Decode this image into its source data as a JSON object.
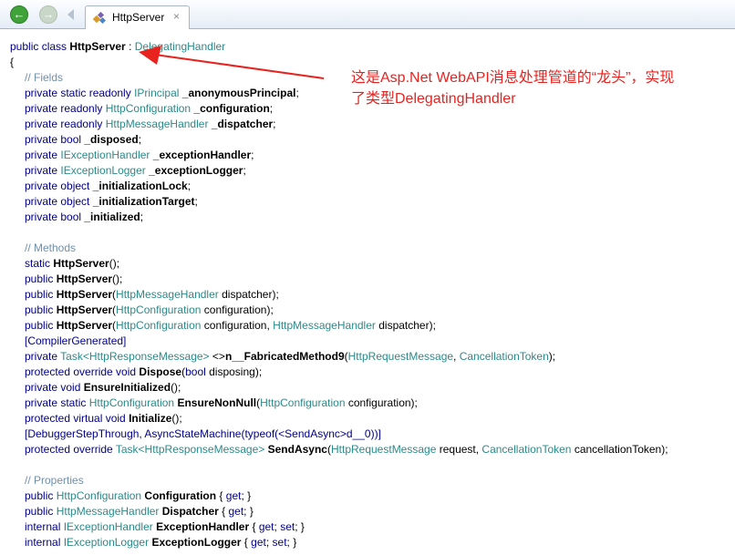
{
  "toolbar": {
    "back_glyph": "←",
    "forward_glyph": "→",
    "tab_title": "HttpServer",
    "tab_close": "×"
  },
  "code": {
    "class_decl": [
      "public class ",
      "HttpServer",
      " : ",
      "DelegatingHandler"
    ],
    "open_brace": "{",
    "fields_comment": "// Fields",
    "fields": [
      [
        "private static readonly ",
        "IPrincipal",
        " ",
        "_anonymousPrincipal",
        ";"
      ],
      [
        "private readonly ",
        "HttpConfiguration",
        " ",
        "_configuration",
        ";"
      ],
      [
        "private readonly ",
        "HttpMessageHandler",
        " ",
        "_dispatcher",
        ";"
      ],
      [
        "private bool ",
        "",
        "",
        "_disposed",
        ";"
      ],
      [
        "private ",
        "IExceptionHandler",
        " ",
        "_exceptionHandler",
        ";"
      ],
      [
        "private ",
        "IExceptionLogger",
        " ",
        "_exceptionLogger",
        ";"
      ],
      [
        "private object ",
        "",
        "",
        "_initializationLock",
        ";"
      ],
      [
        "private object ",
        "",
        "",
        "_initializationTarget",
        ";"
      ],
      [
        "private bool ",
        "",
        "",
        "_initialized",
        ";"
      ]
    ],
    "methods_comment": "// Methods",
    "methods": [
      [
        [
          "kw",
          "static "
        ],
        [
          "nm",
          "HttpServer"
        ],
        [
          "pl",
          "();"
        ]
      ],
      [
        [
          "kw",
          "public "
        ],
        [
          "nm",
          "HttpServer"
        ],
        [
          "pl",
          "();"
        ]
      ],
      [
        [
          "kw",
          "public "
        ],
        [
          "nm",
          "HttpServer"
        ],
        [
          "pl",
          "("
        ],
        [
          "ty",
          "HttpMessageHandler"
        ],
        [
          "pl",
          " dispatcher);"
        ]
      ],
      [
        [
          "kw",
          "public "
        ],
        [
          "nm",
          "HttpServer"
        ],
        [
          "pl",
          "("
        ],
        [
          "ty",
          "HttpConfiguration"
        ],
        [
          "pl",
          " configuration);"
        ]
      ],
      [
        [
          "kw",
          "public "
        ],
        [
          "nm",
          "HttpServer"
        ],
        [
          "pl",
          "("
        ],
        [
          "ty",
          "HttpConfiguration"
        ],
        [
          "pl",
          " configuration, "
        ],
        [
          "ty",
          "HttpMessageHandler"
        ],
        [
          "pl",
          " dispatcher);"
        ]
      ],
      [
        [
          "at",
          "[CompilerGenerated]"
        ]
      ],
      [
        [
          "kw",
          "private "
        ],
        [
          "ty",
          "Task<HttpResponseMessage>"
        ],
        [
          "pl",
          " <>"
        ],
        [
          "nm",
          "n__FabricatedMethod9"
        ],
        [
          "pl",
          "("
        ],
        [
          "ty",
          "HttpRequestMessage"
        ],
        [
          "pl",
          ", "
        ],
        [
          "ty",
          "CancellationToken"
        ],
        [
          "pl",
          ");"
        ]
      ],
      [
        [
          "kw",
          "protected override void "
        ],
        [
          "nm",
          "Dispose"
        ],
        [
          "pl",
          "("
        ],
        [
          "kw",
          "bool"
        ],
        [
          "pl",
          " disposing);"
        ]
      ],
      [
        [
          "kw",
          "private void "
        ],
        [
          "nm",
          "EnsureInitialized"
        ],
        [
          "pl",
          "();"
        ]
      ],
      [
        [
          "kw",
          "private static "
        ],
        [
          "ty",
          "HttpConfiguration"
        ],
        [
          "pl",
          " "
        ],
        [
          "nm",
          "EnsureNonNull"
        ],
        [
          "pl",
          "("
        ],
        [
          "ty",
          "HttpConfiguration"
        ],
        [
          "pl",
          " configuration);"
        ]
      ],
      [
        [
          "kw",
          "protected virtual void "
        ],
        [
          "nm",
          "Initialize"
        ],
        [
          "pl",
          "();"
        ]
      ],
      [
        [
          "at",
          "[DebuggerStepThrough, AsyncStateMachine(typeof(<SendAsync>d__0))]"
        ]
      ],
      [
        [
          "kw",
          "protected override "
        ],
        [
          "ty",
          "Task<HttpResponseMessage>"
        ],
        [
          "pl",
          " "
        ],
        [
          "nm",
          "SendAsync"
        ],
        [
          "pl",
          "("
        ],
        [
          "ty",
          "HttpRequestMessage"
        ],
        [
          "pl",
          " request, "
        ],
        [
          "ty",
          "CancellationToken"
        ],
        [
          "pl",
          " cancellationToken);"
        ]
      ]
    ],
    "properties_comment": "// Properties",
    "properties": [
      [
        [
          "kw",
          "public "
        ],
        [
          "ty",
          "HttpConfiguration"
        ],
        [
          "pl",
          " "
        ],
        [
          "nm",
          "Configuration"
        ],
        [
          "pl",
          " { "
        ],
        [
          "kw",
          "get"
        ],
        [
          "pl",
          "; }"
        ]
      ],
      [
        [
          "kw",
          "public "
        ],
        [
          "ty",
          "HttpMessageHandler"
        ],
        [
          "pl",
          " "
        ],
        [
          "nm",
          "Dispatcher"
        ],
        [
          "pl",
          " { "
        ],
        [
          "kw",
          "get"
        ],
        [
          "pl",
          "; }"
        ]
      ],
      [
        [
          "kw",
          "internal "
        ],
        [
          "ty",
          "IExceptionHandler"
        ],
        [
          "pl",
          " "
        ],
        [
          "nm",
          "ExceptionHandler"
        ],
        [
          "pl",
          " { "
        ],
        [
          "kw",
          "get"
        ],
        [
          "pl",
          "; "
        ],
        [
          "kw",
          "set"
        ],
        [
          "pl",
          "; }"
        ]
      ],
      [
        [
          "kw",
          "internal "
        ],
        [
          "ty",
          "IExceptionLogger"
        ],
        [
          "pl",
          " "
        ],
        [
          "nm",
          "ExceptionLogger"
        ],
        [
          "pl",
          " { "
        ],
        [
          "kw",
          "get"
        ],
        [
          "pl",
          "; "
        ],
        [
          "kw",
          "set"
        ],
        [
          "pl",
          "; }"
        ]
      ]
    ]
  },
  "annotation": {
    "line1": "这是Asp.Net WebAPI消息处理管道的“龙头”，实现",
    "line2": "了类型DelegatingHandler",
    "color": "#e8231f"
  }
}
